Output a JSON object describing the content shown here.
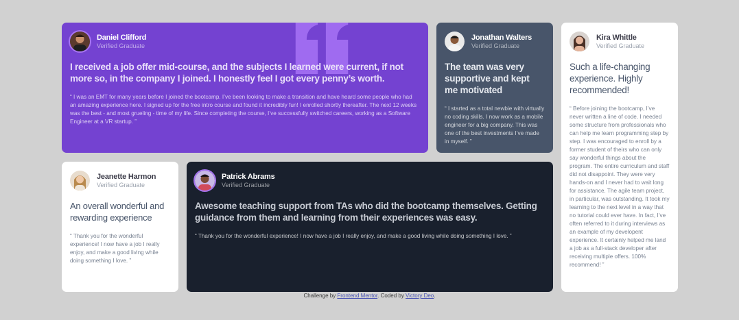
{
  "testimonials": {
    "daniel": {
      "name": "Daniel Clifford",
      "status": "Verified Graduate",
      "headline": "I received a job offer mid-course, and the subjects I learned were current, if not more so, in the company I joined. I honestly feel I got every penny’s worth.",
      "body": "“ I was an EMT for many years before I joined the bootcamp. I’ve been looking to make a transition and have heard some people who had an amazing experience here. I signed up for the free intro course and found it incredibly fun! I enrolled shortly thereafter. The next 12 weeks was the best - and most grueling - time of my life. Since completing the course, I’ve successfully switched careers, working as a Software Engineer at a VR startup. ”"
    },
    "jonathan": {
      "name": "Jonathan Walters",
      "status": "Verified Graduate",
      "headline": "The team was very supportive and kept me motivated",
      "body": "“ I started as a total newbie with virtually no coding skills. I now work as a mobile engineer for a big company. This was one of the best investments I’ve made in myself. ”"
    },
    "kira": {
      "name": "Kira Whittle",
      "status": "Verified Graduate",
      "headline": "Such a life-changing experience. Highly recommended!",
      "body": "“ Before joining the bootcamp, I’ve never written a line of code. I needed some structure from professionals who can help me learn programming step by step. I was encouraged to enroll by a former student of theirs who can only say wonderful things about the program. The entire curriculum and staff did not disappoint. They were very hands-on and I never had to wait long for assistance. The agile team project, in particular, was outstanding. It took my learning to the next level in a way that no tutorial could ever have. In fact, I’ve often referred to it during interviews as an example of my developent experience. It certainly helped me land a job as a full-stack developer after receiving multiple offers. 100% recommend! ”"
    },
    "jeanette": {
      "name": "Jeanette Harmon",
      "status": "Verified Graduate",
      "headline": "An overall wonderful and rewarding experience",
      "body": "“ Thank you for the wonderful experience! I now have a job I really enjoy, and make a good living while doing something I love. ”"
    },
    "patrick": {
      "name": "Patrick Abrams",
      "status": "Verified Graduate",
      "headline": "Awesome teaching support from TAs who did the bootcamp themselves. Getting guidance from them and learning from their experiences was easy.",
      "body": "“ Thank you for the wonderful experience! I now have a job I really enjoy, and make a good living while doing something I love. ”"
    }
  },
  "attribution": {
    "prefix": "Challenge by ",
    "link1": "Frontend Mentor",
    "middle": ". Coded by ",
    "link2": "Victory Deo",
    "suffix": "."
  },
  "colors": {
    "purple": "#7442d1",
    "slate": "#48556a",
    "dark": "#19202d",
    "white": "#ffffff",
    "background": "#d1d1d1"
  },
  "icons": {
    "quote": "quotation-mark-icon"
  }
}
